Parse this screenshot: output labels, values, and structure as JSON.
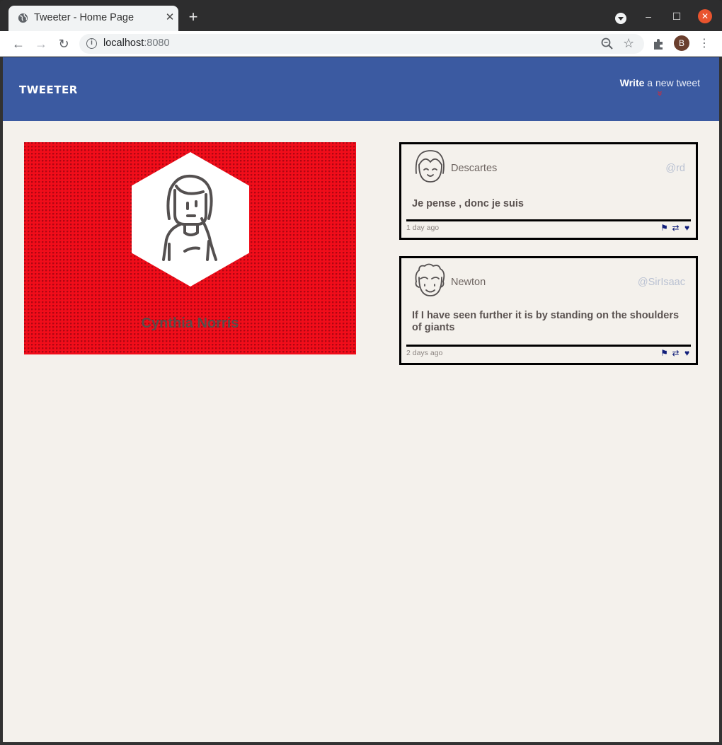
{
  "browser": {
    "tab_title": "Tweeter - Home Page",
    "url_host": "localhost",
    "url_port": ":8080",
    "profile_initial": "B"
  },
  "header": {
    "brand": "TWEETER",
    "compose_bold": "Write",
    "compose_rest": " a new tweet",
    "compose_arrow": "»"
  },
  "profile": {
    "name": "Cynthia Norris",
    "background_color": "#f10d1a"
  },
  "tweets": [
    {
      "name": "Descartes",
      "handle": "@rd",
      "body": "Je pense , donc je suis",
      "time": "1 day ago"
    },
    {
      "name": "Newton",
      "handle": "@SirIsaac",
      "body": "If I have seen further it is by standing on the shoulders of giants",
      "time": "2 days ago"
    }
  ],
  "colors": {
    "header_bg": "#3b5aa1",
    "page_bg": "#f4f1ec",
    "action_icons": "#101e7a",
    "accent_arrow": "#e0282e"
  },
  "icons": {
    "flag": "flag-icon",
    "retweet": "retweet-icon",
    "like": "heart-icon"
  }
}
